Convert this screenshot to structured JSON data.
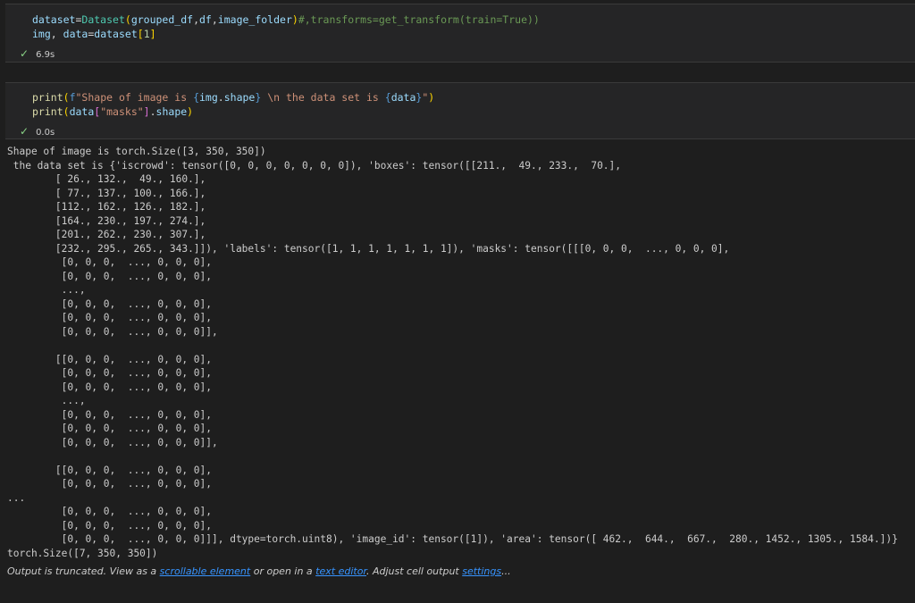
{
  "cells": [
    {
      "lines": [
        [
          {
            "t": "dataset",
            "c": "var"
          },
          {
            "t": "=",
            "c": "plain"
          },
          {
            "t": "Dataset",
            "c": "cls"
          },
          {
            "t": "(",
            "c": "gold"
          },
          {
            "t": "grouped_df",
            "c": "var"
          },
          {
            "t": ",",
            "c": "plain"
          },
          {
            "t": "df",
            "c": "var"
          },
          {
            "t": ",",
            "c": "plain"
          },
          {
            "t": "image_folder",
            "c": "var"
          },
          {
            "t": ")",
            "c": "gold"
          },
          {
            "t": "#,transforms=get_transform(train=True))",
            "c": "cmt"
          }
        ],
        [
          {
            "t": "img",
            "c": "var"
          },
          {
            "t": ", ",
            "c": "plain"
          },
          {
            "t": "data",
            "c": "var"
          },
          {
            "t": "=",
            "c": "plain"
          },
          {
            "t": "dataset",
            "c": "var"
          },
          {
            "t": "[",
            "c": "gold"
          },
          {
            "t": "1",
            "c": "num"
          },
          {
            "t": "]",
            "c": "gold"
          }
        ]
      ],
      "status_check": "✓",
      "status_time": "6.9s"
    },
    {
      "lines": [
        [
          {
            "t": "print",
            "c": "fn"
          },
          {
            "t": "(",
            "c": "gold"
          },
          {
            "t": "f",
            "c": "kw"
          },
          {
            "t": "\"Shape of image is ",
            "c": "str"
          },
          {
            "t": "{",
            "c": "brace"
          },
          {
            "t": "img",
            "c": "var"
          },
          {
            "t": ".",
            "c": "plain"
          },
          {
            "t": "shape",
            "c": "var"
          },
          {
            "t": "}",
            "c": "brace"
          },
          {
            "t": " \\n the data set is ",
            "c": "str"
          },
          {
            "t": "{",
            "c": "brace"
          },
          {
            "t": "data",
            "c": "var"
          },
          {
            "t": "}",
            "c": "brace"
          },
          {
            "t": "\"",
            "c": "str"
          },
          {
            "t": ")",
            "c": "gold"
          }
        ],
        [
          {
            "t": "print",
            "c": "fn"
          },
          {
            "t": "(",
            "c": "gold"
          },
          {
            "t": "data",
            "c": "var"
          },
          {
            "t": "[",
            "c": "pink"
          },
          {
            "t": "\"masks\"",
            "c": "str"
          },
          {
            "t": "]",
            "c": "pink"
          },
          {
            "t": ".",
            "c": "plain"
          },
          {
            "t": "shape",
            "c": "var"
          },
          {
            "t": ")",
            "c": "gold"
          }
        ]
      ],
      "status_check": "✓",
      "status_time": "0.0s"
    }
  ],
  "output": {
    "lines": [
      "Shape of image is torch.Size([3, 350, 350])",
      " the data set is {'iscrowd': tensor([0, 0, 0, 0, 0, 0, 0]), 'boxes': tensor([[211.,  49., 233.,  70.],",
      "        [ 26., 132.,  49., 160.],",
      "        [ 77., 137., 100., 166.],",
      "        [112., 162., 126., 182.],",
      "        [164., 230., 197., 274.],",
      "        [201., 262., 230., 307.],",
      "        [232., 295., 265., 343.]]), 'labels': tensor([1, 1, 1, 1, 1, 1, 1]), 'masks': tensor([[[0, 0, 0,  ..., 0, 0, 0],",
      "         [0, 0, 0,  ..., 0, 0, 0],",
      "         [0, 0, 0,  ..., 0, 0, 0],",
      "         ...,",
      "         [0, 0, 0,  ..., 0, 0, 0],",
      "         [0, 0, 0,  ..., 0, 0, 0],",
      "         [0, 0, 0,  ..., 0, 0, 0]],",
      "",
      "        [[0, 0, 0,  ..., 0, 0, 0],",
      "         [0, 0, 0,  ..., 0, 0, 0],",
      "         [0, 0, 0,  ..., 0, 0, 0],",
      "         ...,",
      "         [0, 0, 0,  ..., 0, 0, 0],",
      "         [0, 0, 0,  ..., 0, 0, 0],",
      "         [0, 0, 0,  ..., 0, 0, 0]],",
      "",
      "        [[0, 0, 0,  ..., 0, 0, 0],",
      "         [0, 0, 0,  ..., 0, 0, 0],",
      "...",
      "         [0, 0, 0,  ..., 0, 0, 0],",
      "         [0, 0, 0,  ..., 0, 0, 0],",
      "         [0, 0, 0,  ..., 0, 0, 0]]], dtype=torch.uint8), 'image_id': tensor([1]), 'area': tensor([ 462.,  644.,  667.,  280., 1452., 1305., 1584.])}",
      "torch.Size([7, 350, 350])"
    ],
    "truncated": {
      "prefix": "Output is truncated. View as a ",
      "link1": "scrollable element",
      "middle1": " or open in a ",
      "link2": "text editor",
      "middle2": ". Adjust cell output ",
      "link3": "settings",
      "suffix": "..."
    }
  },
  "colors": {
    "background": "#1e1e1e",
    "editor_bg": "#252526",
    "link": "#3794ff",
    "success": "#89d185"
  }
}
